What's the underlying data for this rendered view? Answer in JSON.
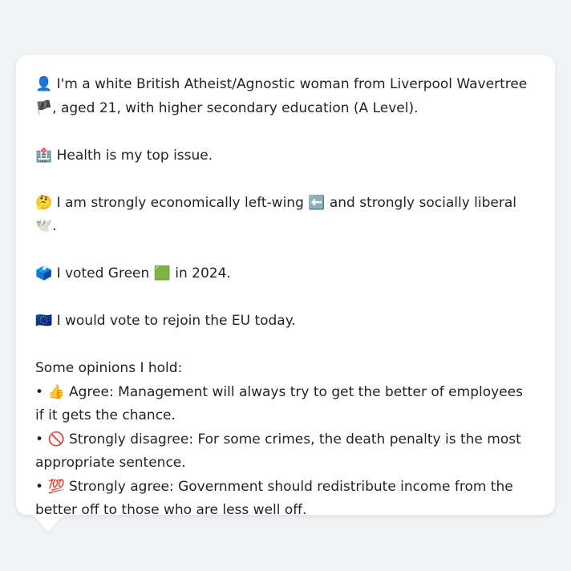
{
  "profile": {
    "intro_icon": "👤",
    "intro_text": " I'm a white British Atheist/Agnostic woman from Liverpool Wavertree 🏴, aged 21, with higher secondary education (A Level).",
    "health_icon": "🏥",
    "health_text": " Health is my top issue.",
    "politics_icon": "🤔",
    "politics_text": " I am strongly economically left-wing ⬅️ and strongly socially liberal 🕊️.",
    "vote_icon": "🗳️",
    "vote_text": " I voted Green 🟩 in 2024.",
    "eu_icon": "🇪🇺",
    "eu_text": " I would vote to rejoin the EU today."
  },
  "opinions": {
    "heading": "Some opinions I hold:",
    "items": [
      {
        "bullet": "• ",
        "icon": "👍",
        "text": " Agree: Management will always try to get the better of employees if it gets the chance."
      },
      {
        "bullet": "• ",
        "icon": "🚫",
        "text": " Strongly disagree: For some crimes, the death penalty is the most appropriate sentence."
      },
      {
        "bullet": "• ",
        "icon": "💯",
        "text": " Strongly agree: Government should redistribute income from the better off to those who are less well off."
      }
    ]
  }
}
